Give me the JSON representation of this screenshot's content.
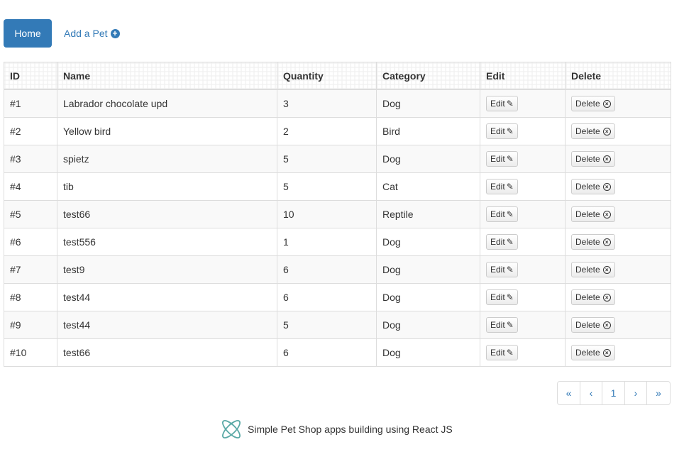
{
  "nav": {
    "home_label": "Home",
    "add_pet_label": "Add a Pet",
    "add_icon": "plus-circle-icon",
    "accent_color": "#337ab7"
  },
  "table": {
    "headers": [
      "ID",
      "Name",
      "Quantity",
      "Category",
      "Edit",
      "Delete"
    ],
    "edit_label": "Edit",
    "delete_label": "Delete",
    "rows": [
      {
        "id": "#1",
        "name": "Labrador chocolate upd",
        "quantity": "3",
        "category": "Dog"
      },
      {
        "id": "#2",
        "name": "Yellow bird",
        "quantity": "2",
        "category": "Bird"
      },
      {
        "id": "#3",
        "name": "spietz",
        "quantity": "5",
        "category": "Dog"
      },
      {
        "id": "#4",
        "name": "tib",
        "quantity": "5",
        "category": "Cat"
      },
      {
        "id": "#5",
        "name": "test66",
        "quantity": "10",
        "category": "Reptile"
      },
      {
        "id": "#6",
        "name": "test556",
        "quantity": "1",
        "category": "Dog"
      },
      {
        "id": "#7",
        "name": "test9",
        "quantity": "6",
        "category": "Dog"
      },
      {
        "id": "#8",
        "name": "test44",
        "quantity": "6",
        "category": "Dog"
      },
      {
        "id": "#9",
        "name": "test44",
        "quantity": "5",
        "category": "Dog"
      },
      {
        "id": "#10",
        "name": "test66",
        "quantity": "6",
        "category": "Dog"
      }
    ]
  },
  "pagination": {
    "first": "«",
    "prev": "‹",
    "current": "1",
    "next": "›",
    "last": "»"
  },
  "footer": {
    "text": "Simple Pet Shop apps building using React JS",
    "logo_icon": "react-logo-icon",
    "logo_color": "#5aa9a6"
  }
}
